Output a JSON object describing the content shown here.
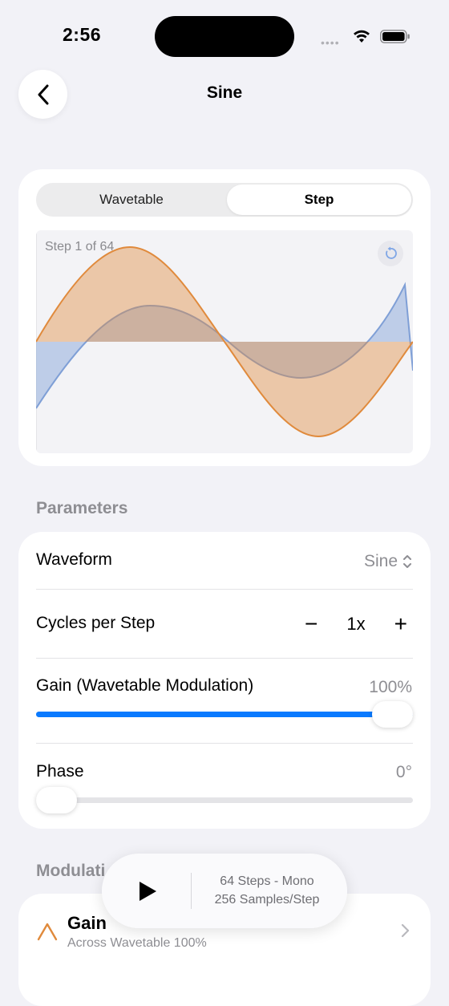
{
  "status": {
    "time": "2:56"
  },
  "nav": {
    "title": "Sine"
  },
  "segments": {
    "wavetable": "Wavetable",
    "step": "Step"
  },
  "preview": {
    "step_label": "Step 1 of 64"
  },
  "parameters": {
    "header": "Parameters",
    "waveform": {
      "label": "Waveform",
      "value": "Sine"
    },
    "cycles": {
      "label": "Cycles per Step",
      "value": "1x",
      "minus": "−",
      "plus": "+"
    },
    "gain": {
      "label": "Gain (Wavetable Modulation)",
      "value": "100%",
      "level": 1.0
    },
    "phase": {
      "label": "Phase",
      "value": "0°",
      "level": 0.0
    }
  },
  "modulation": {
    "header": "Modulati",
    "items": [
      {
        "title": "Gain",
        "subtitle": "Across Wavetable  100%"
      }
    ]
  },
  "player": {
    "line1": "64 Steps - Mono",
    "line2": "256 Samples/Step"
  },
  "colors": {
    "accent": "#0a7aff",
    "orange": "#e08a3c",
    "blue": "#7f9fd6"
  }
}
